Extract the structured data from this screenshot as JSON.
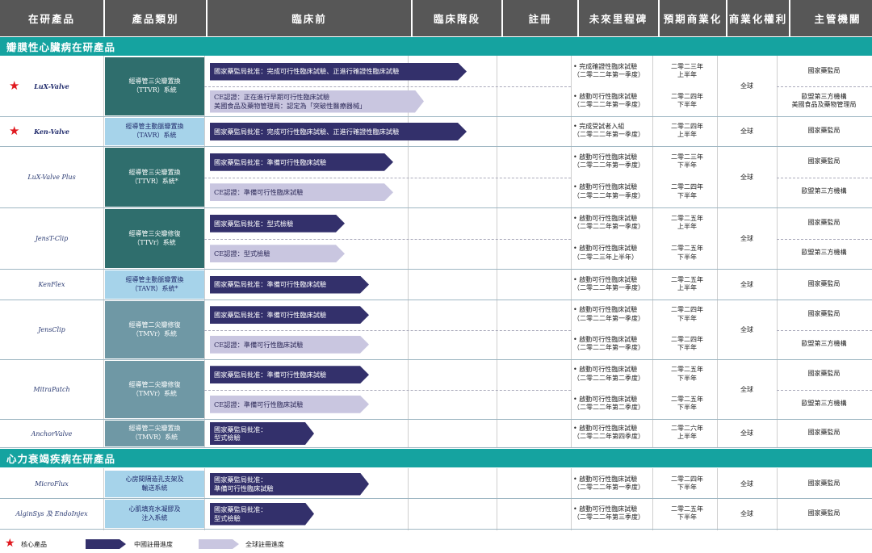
{
  "header": [
    "在研產品",
    "產品類別",
    "臨床前",
    "臨床階段",
    "註冊",
    "未來里程碑",
    "預期商業化",
    "商業化權利",
    "主管機關"
  ],
  "sections": [
    "瓣膜性心臟病在研產品",
    "心力衰竭疾病在研產品"
  ],
  "products": [
    {
      "name": "LuX-Valve",
      "core": true,
      "category": "經導管三尖瓣置換\n（TTVR）系統",
      "rights": "全球",
      "rows": [
        {
          "bar": "國家藥監局批准：完成可行性臨床試驗、正進行確證性臨床試驗",
          "type": "cn",
          "progress": 0.42,
          "milestone": "• 完成確證性臨床試驗\n（二零二二年第一季度）",
          "comm": "二零二三年\n上半年",
          "authority": "國家藥監局"
        },
        {
          "bar": "CE認證：正在進行早期可行性臨床試驗\n美國食品及藥物管理局：認定為「突破性醫療器械」",
          "type": "gl",
          "progress": 0.35,
          "milestone": "• 啟動可行性臨床試驗\n（二零二二年第一季度）",
          "comm": "二零二四年\n下半年",
          "authority": "歐盟第三方機構\n美國食品及藥物管理局"
        }
      ]
    },
    {
      "name": "Ken-Valve",
      "core": true,
      "category": "經導管主動脈瓣置換\n（TAVR）系統",
      "rights": "全球",
      "rows": [
        {
          "bar": "國家藥監局批准：完成可行性臨床試驗、正進行確證性臨床試驗",
          "type": "cn",
          "progress": 0.42,
          "milestone": "• 完成受試者入組\n（二零二二年第一季度）",
          "comm": "二零二四年\n上半年",
          "authority": "國家藥監局"
        }
      ]
    },
    {
      "name": "LuX-Valve Plus",
      "core": false,
      "category": "經導管三尖瓣置換\n（TTVR）系統*",
      "rights": "全球",
      "rows": [
        {
          "bar": "國家藥監局批准：準備可行性臨床試驗",
          "type": "cn",
          "progress": 0.3,
          "milestone": "• 啟動可行性臨床試驗\n（二零二二年第一季度）",
          "comm": "二零二三年\n下半年",
          "authority": "國家藥監局"
        },
        {
          "bar": "CE認證：準備可行性臨床試驗",
          "type": "gl",
          "progress": 0.3,
          "milestone": "• 啟動可行性臨床試驗\n（二零二二年第一季度）",
          "comm": "二零二四年\n下半年",
          "authority": "歐盟第三方機構"
        }
      ]
    },
    {
      "name": "JensT-Clip",
      "core": false,
      "category": "經導管三尖瓣修復\n（TTVr）系統",
      "rights": "全球",
      "rows": [
        {
          "bar": "國家藥監局批准：型式檢驗",
          "type": "cn",
          "progress": 0.22,
          "milestone": "• 啟動可行性臨床試驗\n（二零二二年第一季度）",
          "comm": "二零二五年\n上半年",
          "authority": "國家藥監局"
        },
        {
          "bar": "CE認證：型式檢驗",
          "type": "gl",
          "progress": 0.22,
          "milestone": "• 啟動可行性臨床試驗\n（二零二三年上半年）",
          "comm": "二零二五年\n下半年",
          "authority": "歐盟第三方機構"
        }
      ]
    },
    {
      "name": "KenFlex",
      "core": false,
      "category": "經導管主動脈瓣置換\n（TAVR）系統*",
      "rights": "全球",
      "rows": [
        {
          "bar": "國家藥監局批准：準備可行性臨床試驗",
          "type": "cn",
          "progress": 0.26,
          "milestone": "• 啟動可行性臨床試驗\n（二零二二年第一季度）",
          "comm": "二零二五年\n上半年",
          "authority": "國家藥監局"
        }
      ]
    },
    {
      "name": "JensClip",
      "core": false,
      "category": "經導管二尖瓣修復\n（TMVr）系統",
      "rights": "全球",
      "rows": [
        {
          "bar": "國家藥監局批准：準備可行性臨床試驗",
          "type": "cn",
          "progress": 0.26,
          "milestone": "• 啟動可行性臨床試驗\n（二零二二年第一季度）",
          "comm": "二零二四年\n下半年",
          "authority": "國家藥監局"
        },
        {
          "bar": "CE認證：準備可行性臨床試驗",
          "type": "gl",
          "progress": 0.26,
          "milestone": "• 啟動可行性臨床試驗\n（二零二二年第一季度）",
          "comm": "二零二四年\n下半年",
          "authority": "歐盟第三方機構"
        }
      ]
    },
    {
      "name": "MitraPatch",
      "core": false,
      "category": "經導管二尖瓣修復\n（TMVr）系統",
      "rights": "全球",
      "rows": [
        {
          "bar": "國家藥監局批准：準備可行性臨床試驗",
          "type": "cn",
          "progress": 0.26,
          "milestone": "• 啟動可行性臨床試驗\n（二零二二年第二季度）",
          "comm": "二零二五年\n下半年",
          "authority": "國家藥監局"
        },
        {
          "bar": "CE認證：準備可行性臨床試驗",
          "type": "gl",
          "progress": 0.26,
          "milestone": "• 啟動可行性臨床試驗\n（二零二二年第二季度）",
          "comm": "二零二五年\n下半年",
          "authority": "歐盟第三方機構"
        }
      ]
    },
    {
      "name": "AnchorValve",
      "core": false,
      "category": "經導管二尖瓣置換\n（TMVR）系統",
      "rights": "全球",
      "rows": [
        {
          "bar": "國家藥監局批准：\n型式檢驗",
          "type": "cn",
          "progress": 0.17,
          "milestone": "• 啟動可行性臨床試驗\n（二零二二年第四季度）",
          "comm": "二零二六年\n上半年",
          "authority": "國家藥監局"
        }
      ]
    },
    {
      "name": "MicroFlux",
      "core": false,
      "category": "心房間隔造孔支架及\n輸送系統",
      "rights": "全球",
      "rows": [
        {
          "bar": "國家藥監局批准：\n準備可行性臨床試驗",
          "type": "cn",
          "progress": 0.26,
          "milestone": "• 啟動可行性臨床試驗\n（二零二二年第一季度）",
          "comm": "二零二四年\n下半年",
          "authority": "國家藥監局"
        }
      ]
    },
    {
      "name": "AlginSys 及 EndoInjex",
      "core": false,
      "category": "心肌填充水凝膠及\n注入系統",
      "rights": "全球",
      "rows": [
        {
          "bar": "國家藥監局批准：\n型式檢驗",
          "type": "cn",
          "progress": 0.17,
          "milestone": "• 啟動可行性臨床試驗\n（二零二二年第三季度）",
          "comm": "二零二五年\n下半年",
          "authority": "國家藥監局"
        }
      ]
    }
  ],
  "legend": {
    "core": "核心產品",
    "china": "中國註冊進度",
    "global": "全球註冊進度"
  },
  "colors": {
    "header": "#575757",
    "section": "#15a3a0",
    "china_bar": "#33306b",
    "global_bar": "#c9c6e0",
    "core_star": "#e0191f"
  }
}
